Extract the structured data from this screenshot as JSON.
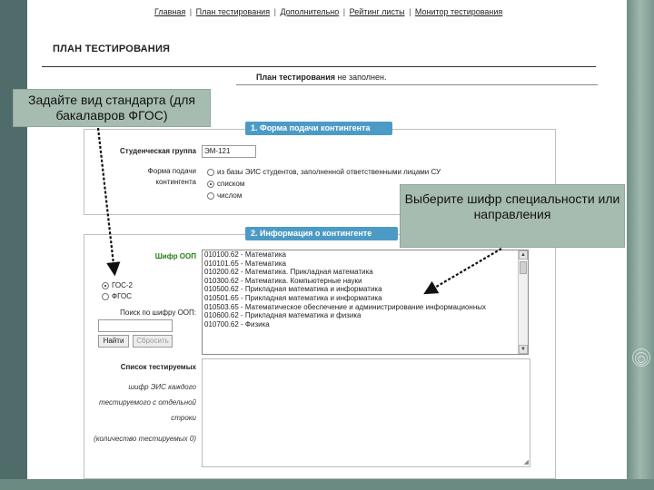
{
  "nav": {
    "items": [
      "Главная",
      "План тестирования",
      "Дополнительно",
      "Рейтинг листы",
      "Монитор тестирования"
    ],
    "separator": "|"
  },
  "page": {
    "title": "ПЛАН ТЕСТИРОВАНИЯ",
    "status_bold": "План тестирования",
    "status_rest": " не заполнен."
  },
  "panel1": {
    "header": "1. Форма подачи контингента",
    "group_label": "Студенческая группа",
    "group_value": "ЭМ-121",
    "form_label_line1": "Форма подачи",
    "form_label_line2": "контингента",
    "options": [
      {
        "label": "из базы ЭИС студентов, заполненной ответственными лицами СУ",
        "selected": false
      },
      {
        "label": "списком",
        "selected": true
      },
      {
        "label": "числом",
        "selected": false
      }
    ]
  },
  "panel2": {
    "header": "2. Информация о контингенте",
    "shifr_label": "Шифр ООП",
    "standards": [
      {
        "label": "ГОС-2",
        "selected": true
      },
      {
        "label": "ФГОС",
        "selected": false
      }
    ],
    "search_label": "Поиск по шифру ООП:",
    "search_value": "",
    "find_button": "Найти",
    "reset_button": "Сбросить",
    "specialties": [
      "010100.62 - Математика",
      "010101.65 - Математика",
      "010200.62 - Математика. Прикладная математика",
      "010300.62 - Математика. Компьютерные науки",
      "010500.62 - Прикладная математика и информатика",
      "010501.65 - Прикладная математика и информатика",
      "010503.65 - Математическое обеспечение и администрирование информационных",
      "010600.62 - Прикладная математика и физика",
      "010700.62 - Физика"
    ],
    "testees_label": "Список тестируемых",
    "note_lines": [
      "шифр ЭИС каждого",
      "тестируемого с отдельной",
      "строки"
    ],
    "count_note": "(количество тестируемых 0)",
    "scroll_up": "▲",
    "scroll_down": "▼",
    "resize_grip": "◢"
  },
  "callouts": {
    "standard": "Задайте вид стандарта (для бакалавров ФГОС)",
    "specialty": "Выберите шифр специальности или направления"
  }
}
